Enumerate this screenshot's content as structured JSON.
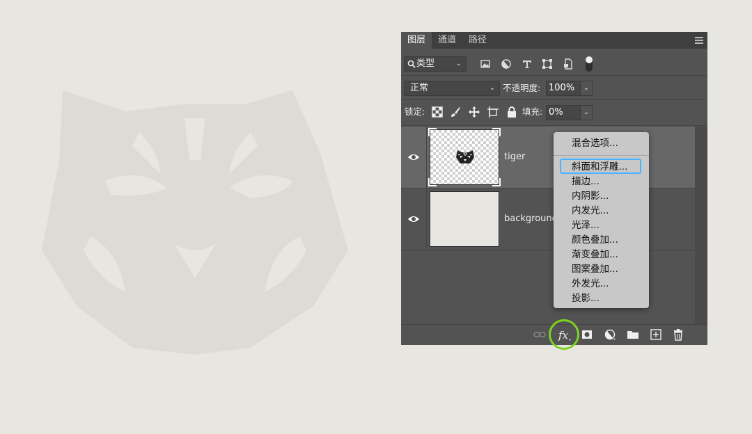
{
  "tabs": [
    {
      "label": "图层",
      "active": true
    },
    {
      "label": "通道",
      "active": false
    },
    {
      "label": "路径",
      "active": false
    }
  ],
  "filter": {
    "kind_label": "类型",
    "icons": [
      "image-filter-icon",
      "adjustment-filter-icon",
      "type-filter-icon",
      "shape-filter-icon",
      "smart-object-filter-icon",
      "filter-toggle-icon"
    ]
  },
  "blend": {
    "mode": "正常",
    "opacity_label": "不透明度:",
    "opacity_value": "100%"
  },
  "lock": {
    "label": "锁定:",
    "icons": [
      "lock-transparent-pixels-icon",
      "lock-image-pixels-icon",
      "lock-position-icon",
      "lock-artboard-icon",
      "lock-all-icon"
    ],
    "fill_label": "填充:",
    "fill_value": "0%"
  },
  "layers": [
    {
      "name": "tiger",
      "selected": true,
      "visible": true
    },
    {
      "name": "background",
      "selected": false,
      "visible": true
    }
  ],
  "bottom_icons": [
    "link-layers-icon",
    "fx-icon",
    "mask-icon",
    "adjustment-layer-icon",
    "group-folder-icon",
    "new-layer-icon",
    "trash-icon"
  ],
  "fx_menu": {
    "items": [
      "混合选项...",
      "斜面和浮雕...",
      "描边...",
      "内阴影...",
      "内发光...",
      "光泽...",
      "颜色叠加...",
      "渐变叠加...",
      "图案叠加...",
      "外发光...",
      "投影..."
    ],
    "highlighted": "斜面和浮雕..."
  },
  "colors": {
    "panel_bg": "#535353",
    "selected_layer": "#676767",
    "menu_highlight": "#4ab3ff",
    "fx_circle": "#7ed321"
  }
}
